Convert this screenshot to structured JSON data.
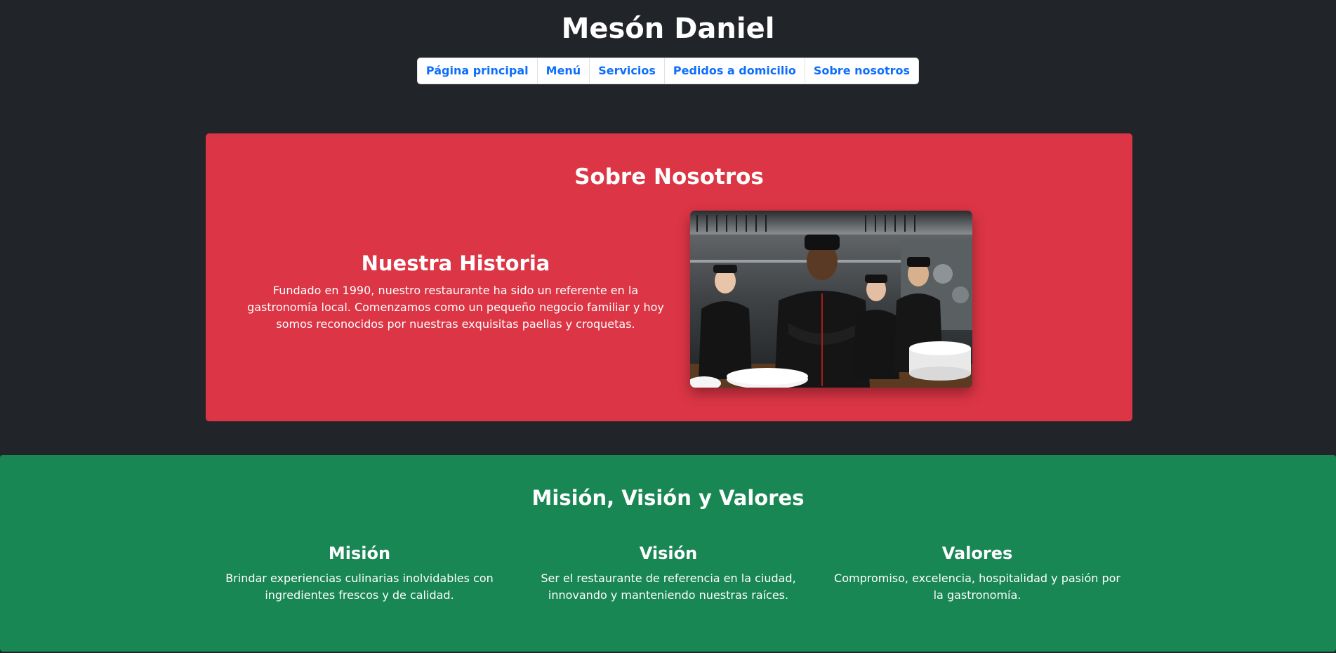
{
  "header": {
    "title": "Mesón Daniel",
    "nav": [
      {
        "label": "Página principal"
      },
      {
        "label": "Menú"
      },
      {
        "label": "Servicios"
      },
      {
        "label": "Pedidos a domicilio"
      },
      {
        "label": "Sobre nosotros"
      }
    ]
  },
  "about": {
    "title": "Sobre Nosotros",
    "history_title": "Nuestra Historia",
    "history_text": "Fundado en 1990, nuestro restaurante ha sido un referente en la gastronomía local. Comenzamos como un pequeño negocio familiar y hoy somos reconocidos por nuestras exquisitas paellas y croquetas."
  },
  "mvv": {
    "title": "Misión, Visión y Valores",
    "columns": [
      {
        "title": "Misión",
        "text": "Brindar experiencias culinarias inolvidables con ingredientes frescos y de calidad."
      },
      {
        "title": "Visión",
        "text": "Ser el restaurante de referencia en la ciudad, innovando y manteniendo nuestras raíces."
      },
      {
        "title": "Valores",
        "text": "Compromiso, excelencia, hospitalidad y pasión por la gastronomía."
      }
    ]
  },
  "colors": {
    "page_bg": "#212529",
    "about_bg": "#dc3545",
    "mvv_bg": "#198754",
    "nav_link": "#0d6efd"
  }
}
